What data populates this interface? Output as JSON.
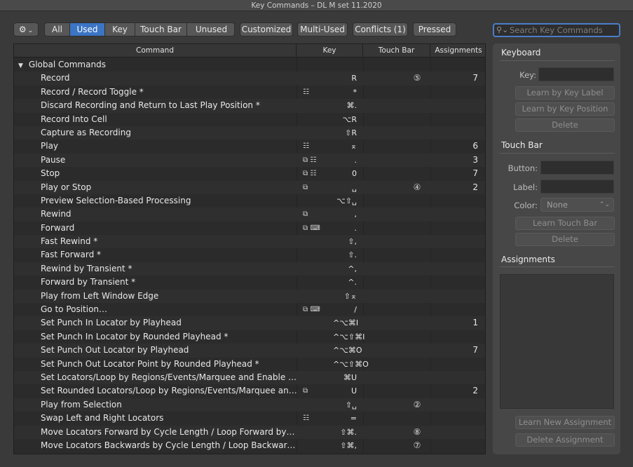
{
  "window": {
    "title": "Key Commands – DL M set 11.2020"
  },
  "toolbar": {
    "gear_caret": "⌄",
    "filters": [
      "All",
      "Used",
      "Key",
      "Touch Bar",
      "Unused"
    ],
    "active_filter": "Used",
    "customized": "Customized",
    "multi_used": "Multi-Used",
    "conflicts": "Conflicts (1)",
    "pressed": "Pressed",
    "search_placeholder": "Search Key Commands"
  },
  "table": {
    "headers": {
      "command": "Command",
      "key": "Key",
      "touch_bar": "Touch Bar",
      "assignments": "Assignments"
    },
    "rows": [
      {
        "cmd": "Global Commands",
        "icons": "",
        "key": "",
        "tb": "",
        "asg": "",
        "group": true
      },
      {
        "cmd": "Record",
        "icons": "",
        "key": "R",
        "tb": "⑤",
        "asg": "7"
      },
      {
        "cmd": "Record / Record Toggle *",
        "icons": "☷",
        "key": "*",
        "tb": "",
        "asg": ""
      },
      {
        "cmd": "Discard Recording and Return to Last Play Position *",
        "icons": "",
        "key": "⌘.",
        "tb": "",
        "asg": ""
      },
      {
        "cmd": "Record Into Cell",
        "icons": "",
        "key": "⌥R",
        "tb": "",
        "asg": ""
      },
      {
        "cmd": "Capture as Recording",
        "icons": "",
        "key": "⇧R",
        "tb": "",
        "asg": ""
      },
      {
        "cmd": "Play",
        "icons": "☷",
        "key": "⌅",
        "tb": "",
        "asg": "6"
      },
      {
        "cmd": "Pause",
        "icons": "⧉ ☷",
        "key": ".",
        "tb": "",
        "asg": "3"
      },
      {
        "cmd": "Stop",
        "icons": "⧉ ☷",
        "key": "0",
        "tb": "",
        "asg": "7"
      },
      {
        "cmd": "Play or Stop",
        "icons": "⧉",
        "key": "␣",
        "tb": "④",
        "asg": "2"
      },
      {
        "cmd": "Preview Selection-Based Processing",
        "icons": "",
        "key": "⌥⇧␣",
        "tb": "",
        "asg": ""
      },
      {
        "cmd": "Rewind",
        "icons": "⧉",
        "key": ",",
        "tb": "",
        "asg": ""
      },
      {
        "cmd": "Forward",
        "icons": "⧉ ⌨",
        "key": ".",
        "tb": "",
        "asg": ""
      },
      {
        "cmd": "Fast Rewind *",
        "icons": "",
        "key": "⇧,",
        "tb": "",
        "asg": ""
      },
      {
        "cmd": "Fast Forward *",
        "icons": "",
        "key": "⇧.",
        "tb": "",
        "asg": ""
      },
      {
        "cmd": "Rewind by Transient *",
        "icons": "",
        "key": "^,",
        "tb": "",
        "asg": ""
      },
      {
        "cmd": "Forward by Transient *",
        "icons": "",
        "key": "^.",
        "tb": "",
        "asg": ""
      },
      {
        "cmd": "Play from Left Window Edge",
        "icons": "",
        "key": "⇧⌅",
        "tb": "",
        "asg": ""
      },
      {
        "cmd": "Go to Position…",
        "icons": "⧉ ⌨",
        "key": "/",
        "tb": "",
        "asg": ""
      },
      {
        "cmd": "Set Punch In Locator by Playhead",
        "icons": "",
        "key": "^⌥⌘I",
        "tb": "",
        "asg": "1"
      },
      {
        "cmd": "Set Punch In Locator by Rounded Playhead *",
        "icons": "",
        "key": "^⌥⇧⌘I",
        "tb": "",
        "asg": ""
      },
      {
        "cmd": "Set Punch Out Locator by Playhead",
        "icons": "",
        "key": "^⌥⌘O",
        "tb": "",
        "asg": "7"
      },
      {
        "cmd": "Set Punch Out Locator Point by Rounded Playhead *",
        "icons": "",
        "key": "^⌥⇧⌘O",
        "tb": "",
        "asg": ""
      },
      {
        "cmd": "Set Locators/Loop by Regions/Events/Marquee and Enable Cycle/L…",
        "icons": "",
        "key": "⌘U",
        "tb": "",
        "asg": ""
      },
      {
        "cmd": "Set Rounded Locators/Loop by Regions/Events/Marquee and Enabl…",
        "icons": "⧉",
        "key": "U",
        "tb": "",
        "asg": "2"
      },
      {
        "cmd": "Play from Selection",
        "icons": "",
        "key": "⇧␣",
        "tb": "②",
        "asg": ""
      },
      {
        "cmd": "Swap Left and Right Locators",
        "icons": "☷",
        "key": "=",
        "tb": "",
        "asg": ""
      },
      {
        "cmd": "Move Locators Forward by Cycle Length / Loop Forward by Loop L…",
        "icons": "",
        "key": "⇧⌘.",
        "tb": "⑧",
        "asg": ""
      },
      {
        "cmd": "Move Locators Backwards by Cycle Length / Loop Backwards by L…",
        "icons": "",
        "key": "⇧⌘,",
        "tb": "⑦",
        "asg": ""
      }
    ]
  },
  "inspector": {
    "keyboard": {
      "title": "Keyboard",
      "key_label": "Key:",
      "learn_label": "Learn by Key Label",
      "learn_position": "Learn by Key Position",
      "delete": "Delete"
    },
    "touch_bar": {
      "title": "Touch Bar",
      "button_label": "Button:",
      "label_label": "Label:",
      "color_label": "Color:",
      "color_value": "None",
      "learn": "Learn Touch Bar",
      "delete": "Delete"
    },
    "assignments": {
      "title": "Assignments",
      "learn_new": "Learn New Assignment",
      "delete": "Delete Assignment"
    }
  },
  "colors": {
    "accent": "#3b75c4",
    "background": "#3a3a3a",
    "table_bg": "#2b2b2b",
    "panel_bg": "#474747"
  }
}
